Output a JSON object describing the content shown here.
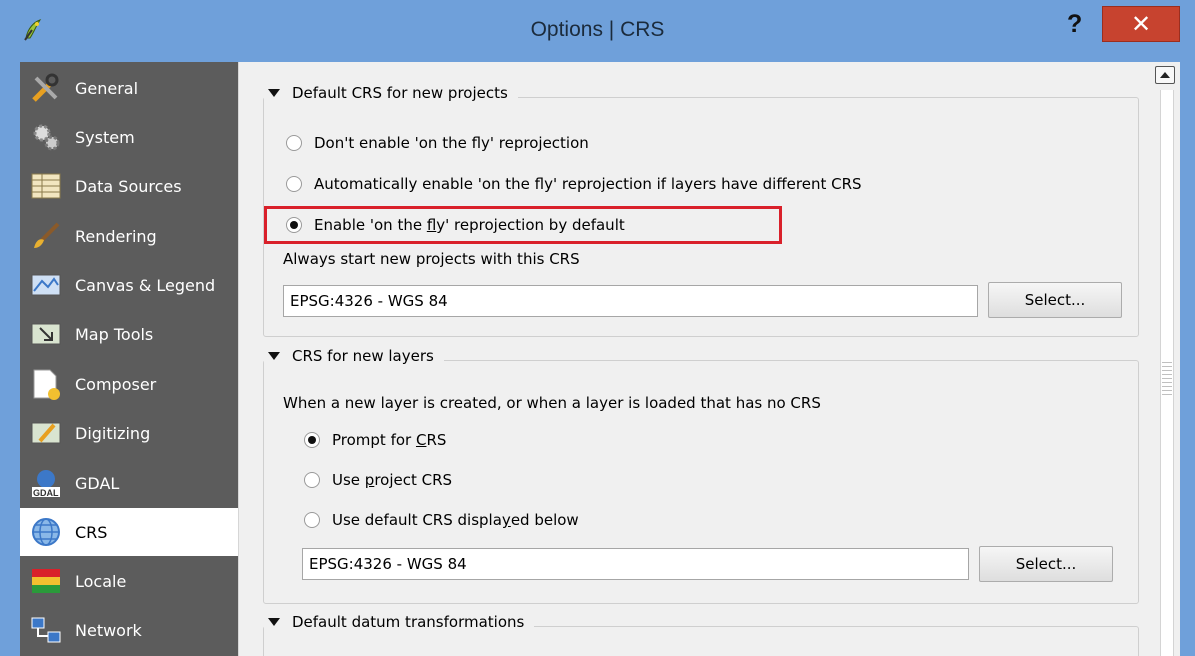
{
  "window": {
    "title": "Options | CRS",
    "help_label": "?",
    "close_label": "✕",
    "accent": "#6fa0da"
  },
  "sidebar": {
    "items": [
      {
        "label": "General",
        "icon": "tools-icon"
      },
      {
        "label": "System",
        "icon": "gears-icon"
      },
      {
        "label": "Data Sources",
        "icon": "table-icon"
      },
      {
        "label": "Rendering",
        "icon": "brush-icon"
      },
      {
        "label": "Canvas & Legend",
        "icon": "canvas-icon"
      },
      {
        "label": "Map Tools",
        "icon": "map-tools-icon"
      },
      {
        "label": "Composer",
        "icon": "composer-icon"
      },
      {
        "label": "Digitizing",
        "icon": "digitizing-icon"
      },
      {
        "label": "GDAL",
        "icon": "gdal-icon"
      },
      {
        "label": "CRS",
        "icon": "globe-icon",
        "active": true
      },
      {
        "label": "Locale",
        "icon": "flag-icon"
      },
      {
        "label": "Network",
        "icon": "network-icon"
      }
    ]
  },
  "default_crs": {
    "title": "Default CRS for new projects",
    "options": [
      {
        "label": "Don't enable 'on the fly' reprojection",
        "checked": false
      },
      {
        "label": "Automatically enable 'on the fly' reprojection if layers have different CRS",
        "checked": false
      },
      {
        "label_pre": "Enable 'on the ",
        "label_u": "f",
        "label_post": "ly' reprojection by default",
        "checked": true
      }
    ],
    "start_label": "Always start new projects with this CRS",
    "crs_value": "EPSG:4326 - WGS 84",
    "select_label": "Select..."
  },
  "new_layers": {
    "title": "CRS for new layers",
    "description": "When a new layer is created, or when a layer is loaded that has no CRS",
    "options": [
      {
        "label_pre": "Prompt for ",
        "label_u": "C",
        "label_post": "RS",
        "checked": true
      },
      {
        "label_pre": "Use ",
        "label_u": "p",
        "label_post": "roject CRS",
        "checked": false
      },
      {
        "label_pre": "Use default CRS displa",
        "label_u": "y",
        "label_post": "ed below",
        "checked": false
      }
    ],
    "crs_value": "EPSG:4326 - WGS 84",
    "select_label": "Select..."
  },
  "datum": {
    "title": "Default datum transformations"
  }
}
